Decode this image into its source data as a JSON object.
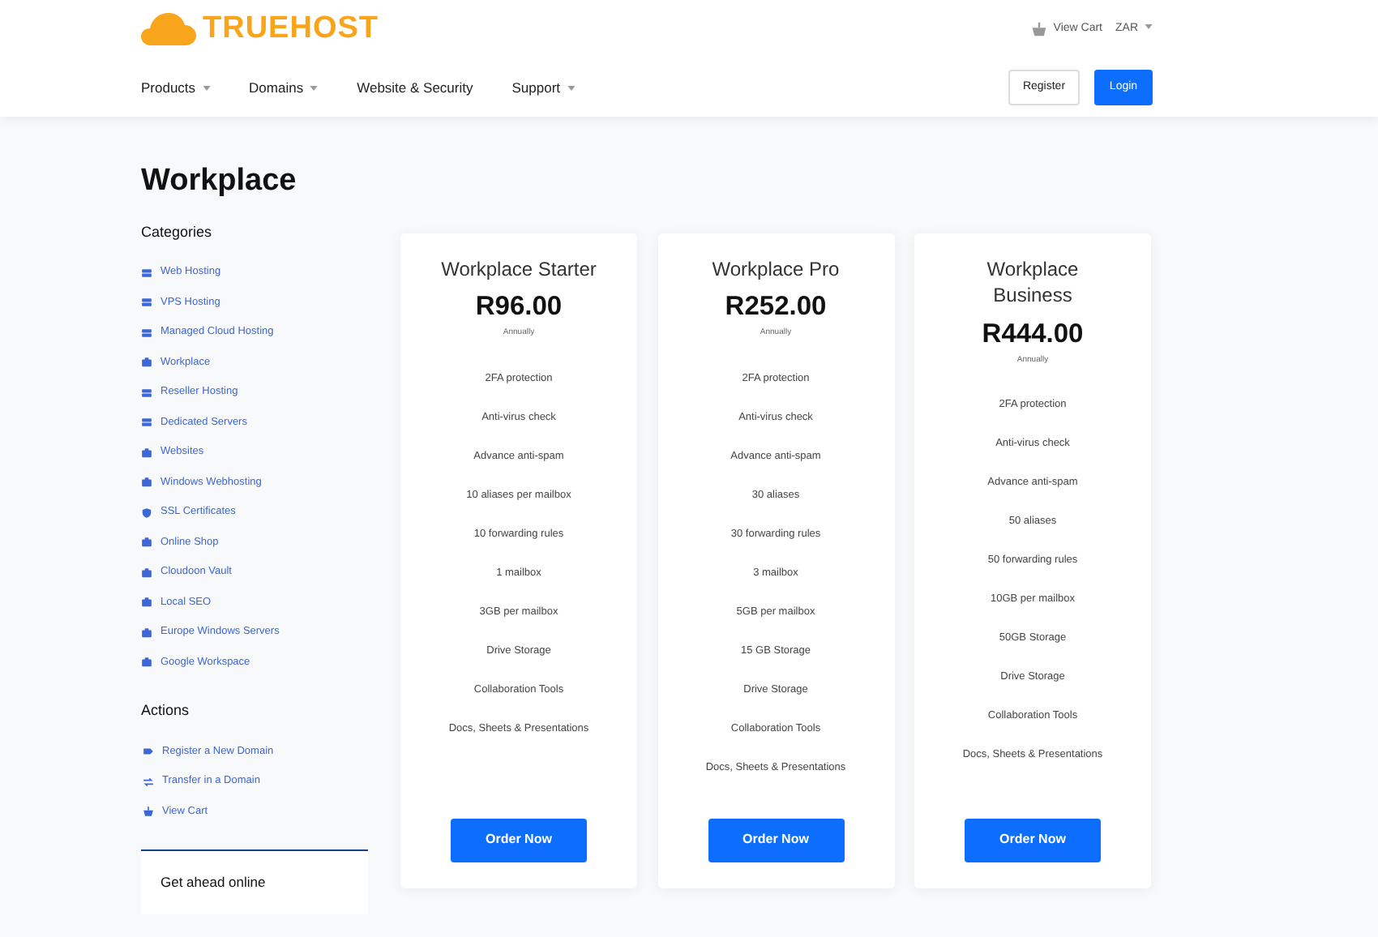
{
  "brand": {
    "name": "TRUEHOST"
  },
  "topbar": {
    "cart": "View Cart",
    "currency": "ZAR"
  },
  "nav": [
    {
      "label": "Products",
      "dropdown": true
    },
    {
      "label": "Domains",
      "dropdown": true
    },
    {
      "label": "Website & Security",
      "dropdown": false
    },
    {
      "label": "Support",
      "dropdown": true
    }
  ],
  "auth": {
    "register": "Register",
    "login": "Login"
  },
  "page_title": "Workplace",
  "sidebar": {
    "categories_title": "Categories",
    "categories": [
      {
        "label": "Web Hosting",
        "kind": "server"
      },
      {
        "label": "VPS Hosting",
        "kind": "server"
      },
      {
        "label": "Managed Cloud Hosting",
        "kind": "server"
      },
      {
        "label": "Workplace",
        "kind": "box"
      },
      {
        "label": "Reseller Hosting",
        "kind": "server"
      },
      {
        "label": "Dedicated Servers",
        "kind": "server"
      },
      {
        "label": "Websites",
        "kind": "box"
      },
      {
        "label": "Windows Webhosting",
        "kind": "box"
      },
      {
        "label": "SSL Certificates",
        "kind": "shield"
      },
      {
        "label": "Online Shop",
        "kind": "box"
      },
      {
        "label": "Cloudoon Vault",
        "kind": "box"
      },
      {
        "label": "Local SEO",
        "kind": "box"
      },
      {
        "label": "Europe Windows Servers",
        "kind": "box"
      },
      {
        "label": "Google Workspace",
        "kind": "box"
      }
    ],
    "actions_title": "Actions",
    "actions": [
      {
        "label": "Register a New Domain",
        "kind": "tag"
      },
      {
        "label": "Transfer in a Domain",
        "kind": "transfer"
      },
      {
        "label": "View Cart",
        "kind": "cart"
      }
    ],
    "promo": {
      "title": "Get ahead online"
    }
  },
  "plans": [
    {
      "name": "Workplace Starter",
      "price": "R96.00",
      "cycle": "Annually",
      "features": [
        "2FA protection",
        "Anti-virus check",
        "Advance anti-spam",
        "10 aliases per mailbox",
        "10 forwarding rules",
        "1 mailbox",
        "3GB per mailbox",
        "Drive Storage",
        "Collaboration Tools",
        "Docs, Sheets & Presentations"
      ],
      "button": "Order Now"
    },
    {
      "name": "Workplace Pro",
      "price": "R252.00",
      "cycle": "Annually",
      "features": [
        "2FA protection",
        "Anti-virus check",
        "Advance anti-spam",
        "30 aliases",
        "30 forwarding rules",
        "3 mailbox",
        "5GB per mailbox",
        "15 GB Storage",
        "Drive Storage",
        "Collaboration Tools",
        "Docs, Sheets & Presentations"
      ],
      "button": "Order Now"
    },
    {
      "name": "Workplace Business",
      "price": "R444.00",
      "cycle": "Annually",
      "features": [
        "2FA protection",
        "Anti-virus check",
        "Advance anti-spam",
        "50 aliases",
        "50 forwarding rules",
        "10GB per mailbox",
        "50GB Storage",
        "Drive Storage",
        "Collaboration Tools",
        "Docs, Sheets & Presentations"
      ],
      "button": "Order Now"
    }
  ]
}
